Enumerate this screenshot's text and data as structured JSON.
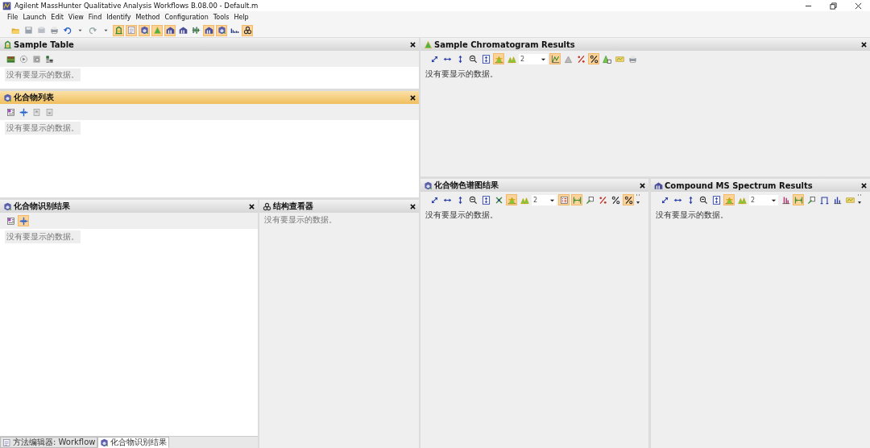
{
  "window": {
    "title": "Agilent MassHunter Qualitative Analysis Workflows B.08.00 - Default.m"
  },
  "menu": [
    "File",
    "Launch",
    "Edit",
    "View",
    "Find",
    "Identify",
    "Method",
    "Configuration",
    "Tools",
    "Help"
  ],
  "toolbar": [
    {
      "kind": "button",
      "on": false
    },
    {
      "kind": "button",
      "on": false
    },
    {
      "kind": "button",
      "on": false
    },
    {
      "kind": "button",
      "on": false
    },
    {
      "kind": "button",
      "on": false
    },
    {
      "kind": "button",
      "on": false
    },
    {
      "kind": "button",
      "on": false
    },
    {
      "kind": "button",
      "on": false
    },
    {
      "kind": "button",
      "on": true
    },
    {
      "kind": "button",
      "on": true
    },
    {
      "kind": "button",
      "on": true
    },
    {
      "kind": "button",
      "on": true
    },
    {
      "kind": "button",
      "on": true
    },
    {
      "kind": "button",
      "on": false
    },
    {
      "kind": "button",
      "on": false
    },
    {
      "kind": "button",
      "on": true
    },
    {
      "kind": "button",
      "on": true
    },
    {
      "kind": "button",
      "on": false
    },
    {
      "kind": "button",
      "on": true
    }
  ],
  "panels": [
    {
      "title": "Sample Table",
      "active": false,
      "message": "没有要显示的数据。",
      "toolbar": [
        {
          "kind": "button",
          "on": false
        },
        {
          "kind": "button",
          "on": false
        },
        {
          "kind": "button",
          "on": false
        },
        {
          "kind": "button",
          "on": false
        }
      ]
    },
    {
      "title": "化合物列表",
      "active": true,
      "message": "没有要显示的数据。",
      "toolbar": [
        {
          "kind": "button",
          "on": false
        },
        {
          "kind": "button",
          "on": false
        },
        {
          "kind": "button",
          "on": false
        },
        {
          "kind": "button",
          "on": false
        }
      ]
    },
    {
      "title": "化合物识别结果",
      "active": false,
      "message": "没有要显示的数据。",
      "toolbar": [
        {
          "kind": "button",
          "on": false
        },
        {
          "kind": "button",
          "on": true
        }
      ]
    },
    {
      "title": "结构查看器",
      "active": false,
      "message": "没有要显示的数据。"
    },
    {
      "title": "Sample Chromatogram Results",
      "active": false,
      "message": "没有要显示的数据。",
      "toolbar": [
        {
          "kind": "button",
          "on": false
        },
        {
          "kind": "button",
          "on": false
        },
        {
          "kind": "button",
          "on": false
        },
        {
          "kind": "button",
          "on": false
        },
        {
          "kind": "button",
          "on": false
        },
        {
          "kind": "button",
          "on": true
        },
        {
          "kind": "button",
          "on": false
        },
        {
          "kind": "dropdown",
          "value": "2"
        },
        {
          "kind": "button",
          "on": true
        },
        {
          "kind": "button",
          "on": false
        },
        {
          "kind": "button",
          "on": false
        },
        {
          "kind": "button",
          "on": true
        },
        {
          "kind": "button",
          "on": false
        },
        {
          "kind": "button",
          "on": false
        },
        {
          "kind": "button",
          "on": false
        }
      ]
    },
    {
      "title": "化合物色谱图结果",
      "active": false,
      "message": "没有要显示的数据。",
      "toolbar": [
        {
          "kind": "button",
          "on": false
        },
        {
          "kind": "button",
          "on": false
        },
        {
          "kind": "button",
          "on": false
        },
        {
          "kind": "button",
          "on": false
        },
        {
          "kind": "button",
          "on": false
        },
        {
          "kind": "button",
          "on": false
        },
        {
          "kind": "button",
          "on": true
        },
        {
          "kind": "button",
          "on": false
        },
        {
          "kind": "dropdown",
          "value": "2"
        },
        {
          "kind": "button",
          "on": true
        },
        {
          "kind": "button",
          "on": true
        },
        {
          "kind": "button",
          "on": false
        },
        {
          "kind": "button",
          "on": false
        },
        {
          "kind": "button",
          "on": false
        },
        {
          "kind": "button",
          "on": true
        },
        {
          "kind": "more"
        }
      ]
    },
    {
      "title": "Compound MS Spectrum Results",
      "active": false,
      "message": "没有要显示的数据。",
      "toolbar": [
        {
          "kind": "button",
          "on": false
        },
        {
          "kind": "button",
          "on": false
        },
        {
          "kind": "button",
          "on": false
        },
        {
          "kind": "button",
          "on": false
        },
        {
          "kind": "button",
          "on": false
        },
        {
          "kind": "button",
          "on": true
        },
        {
          "kind": "button",
          "on": false
        },
        {
          "kind": "dropdown",
          "value": "2"
        },
        {
          "kind": "button",
          "on": false
        },
        {
          "kind": "button",
          "on": true
        },
        {
          "kind": "button",
          "on": false
        },
        {
          "kind": "button",
          "on": false
        },
        {
          "kind": "button",
          "on": false
        },
        {
          "kind": "button",
          "on": false
        },
        {
          "kind": "more"
        }
      ]
    }
  ],
  "bottom_tabs": [
    {
      "label": "方法编辑器: Workflow",
      "selected": false
    },
    {
      "label": "化合物识别结果",
      "selected": true
    }
  ]
}
